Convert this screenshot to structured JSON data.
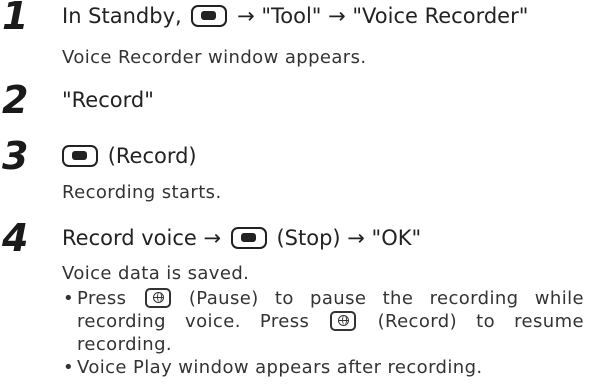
{
  "steps": [
    {
      "number": "1",
      "parts": [
        "In Standby,",
        "→ \"Tool\" → \"Voice Recorder\""
      ],
      "description": "Voice Recorder window appears."
    },
    {
      "number": "2",
      "text": "\"Record\""
    },
    {
      "number": "3",
      "parts": [
        "(Record)"
      ],
      "description": "Recording starts."
    },
    {
      "number": "4",
      "parts": [
        "Record voice →",
        "(Stop) → \"OK\""
      ],
      "description": "Voice data is saved."
    }
  ],
  "bullets": {
    "marker": "•",
    "item1": {
      "parts": [
        "Press",
        "(Pause) to pause the recording",
        "while recording voice. Press",
        "(Record) to",
        "resume recording."
      ]
    },
    "item2": {
      "text": "Voice Play window appears after recording."
    }
  },
  "icons": {
    "center_key": "center-key-icon",
    "pause_record_key": "globe-key-icon"
  }
}
